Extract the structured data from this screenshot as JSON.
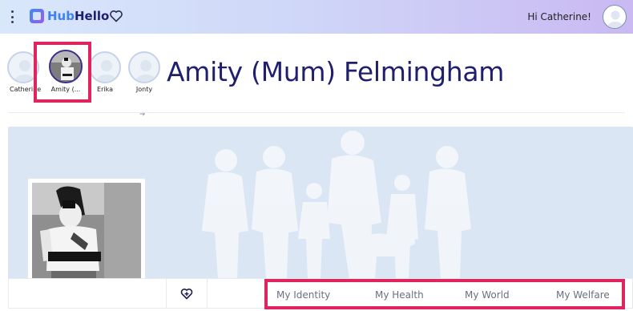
{
  "app": {
    "logo_part1": "Hub",
    "logo_part2": "Hello",
    "greeting": "Hi Catherine!"
  },
  "people": [
    {
      "name": "Catherine",
      "active": false
    },
    {
      "name": "Amity (...",
      "active": true
    },
    {
      "name": "Erika",
      "active": false
    },
    {
      "name": "Jonty",
      "active": false
    }
  ],
  "profile": {
    "title": "Amity (Mum) Felmingham"
  },
  "tabs": [
    {
      "label": "My Identity"
    },
    {
      "label": "My Health"
    },
    {
      "label": "My World"
    },
    {
      "label": "My Welfare"
    }
  ],
  "colors": {
    "brand_dark": "#1f1f6e",
    "brand_blue": "#3b82f6",
    "highlight_red": "#e0245e",
    "banner_bg": "#dbe6f4"
  },
  "icons": {
    "top_heart": "heart-outline-icon",
    "tab_heart": "heart-plus-icon",
    "menu": "kebab-menu-icon",
    "arrow": "arrow-right-icon"
  }
}
